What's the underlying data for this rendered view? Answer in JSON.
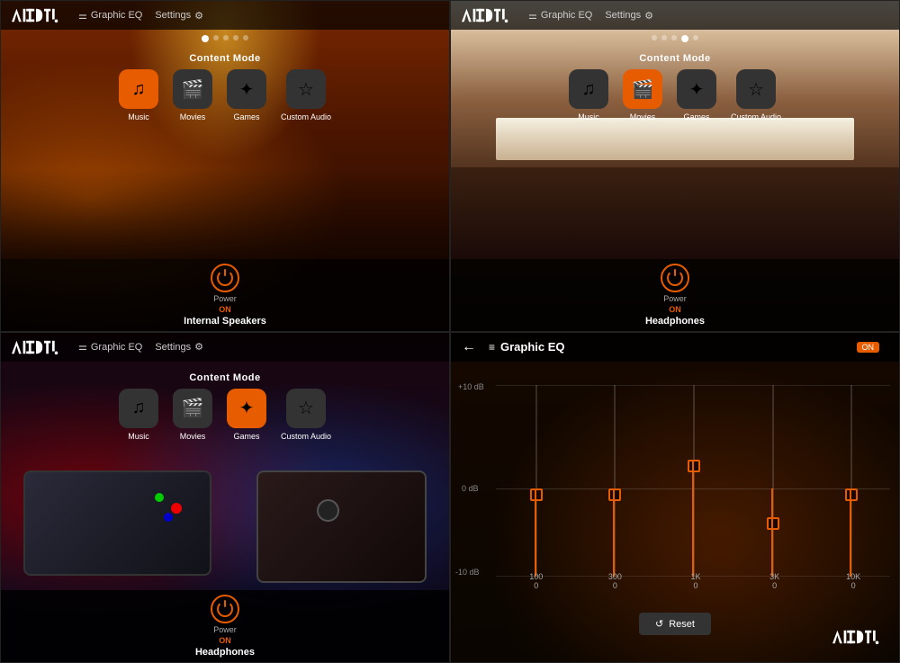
{
  "panels": [
    {
      "id": "panel-music",
      "type": "content",
      "bg": "concert",
      "header": {
        "nav_items": [
          "Graphic EQ",
          "Settings"
        ]
      },
      "content_mode": {
        "label": "Content Mode",
        "buttons": [
          {
            "id": "music",
            "label": "Music",
            "icon": "♪",
            "active": true
          },
          {
            "id": "movies",
            "label": "Movies",
            "icon": "🎬",
            "active": false
          },
          {
            "id": "games",
            "label": "Games",
            "icon": "⚙",
            "active": false
          },
          {
            "id": "custom",
            "label": "Custom Audio",
            "icon": "☆",
            "active": false
          }
        ]
      },
      "power": {
        "label": "Power",
        "status": "ON"
      },
      "device": "Internal Speakers",
      "dots": [
        true,
        false,
        false,
        false,
        false
      ]
    },
    {
      "id": "panel-movies",
      "type": "content",
      "bg": "theater",
      "header": {
        "nav_items": [
          "Graphic EQ",
          "Settings"
        ]
      },
      "content_mode": {
        "label": "Content Mode",
        "buttons": [
          {
            "id": "music",
            "label": "Music",
            "icon": "♪",
            "active": false
          },
          {
            "id": "movies",
            "label": "Movies",
            "icon": "🎬",
            "active": true
          },
          {
            "id": "games",
            "label": "Games",
            "icon": "⚙",
            "active": false
          },
          {
            "id": "custom",
            "label": "Custom Audio",
            "icon": "☆",
            "active": false
          }
        ]
      },
      "power": {
        "label": "Power",
        "status": "ON"
      },
      "device": "Headphones",
      "dots": [
        false,
        false,
        false,
        true,
        false
      ]
    },
    {
      "id": "panel-games",
      "type": "content",
      "bg": "games",
      "header": {
        "nav_items": [
          "Graphic EQ",
          "Settings"
        ]
      },
      "content_mode": {
        "label": "Content Mode",
        "buttons": [
          {
            "id": "music",
            "label": "Music",
            "icon": "♪",
            "active": false
          },
          {
            "id": "movies",
            "label": "Movies",
            "icon": "🎬",
            "active": false
          },
          {
            "id": "games",
            "label": "Games",
            "icon": "⚙",
            "active": true
          },
          {
            "id": "custom",
            "label": "Custom Audio",
            "icon": "☆",
            "active": false
          }
        ]
      },
      "power": {
        "label": "Power",
        "status": "ON"
      },
      "device": "Headphones",
      "dots": [
        false,
        false,
        true,
        false,
        false
      ]
    },
    {
      "id": "panel-eq",
      "type": "eq",
      "bg": "eq",
      "eq": {
        "title": "Graphic EQ",
        "on_label": "ON",
        "sliders": [
          {
            "freq": "100",
            "val": "0",
            "position": 50
          },
          {
            "freq": "300",
            "val": "0",
            "position": 50
          },
          {
            "freq": "1K",
            "val": "0",
            "position": 70
          },
          {
            "freq": "3K",
            "val": "0",
            "position": 35
          },
          {
            "freq": "10K",
            "val": "0",
            "position": 50
          }
        ],
        "y_labels": [
          "+10 dB",
          "0 dB",
          "-10 dB"
        ],
        "reset_label": "Reset"
      }
    }
  ],
  "icons": {
    "music": "♫",
    "movies": "🎬",
    "games": "✦",
    "custom": "☆",
    "eq_bars": "≡",
    "settings": "⚙",
    "back": "←",
    "reset": "↺",
    "power": "⏻"
  },
  "colors": {
    "orange": "#e85c00",
    "dark_bg": "#111111",
    "header_bg": "rgba(0,0,0,0.75)"
  }
}
